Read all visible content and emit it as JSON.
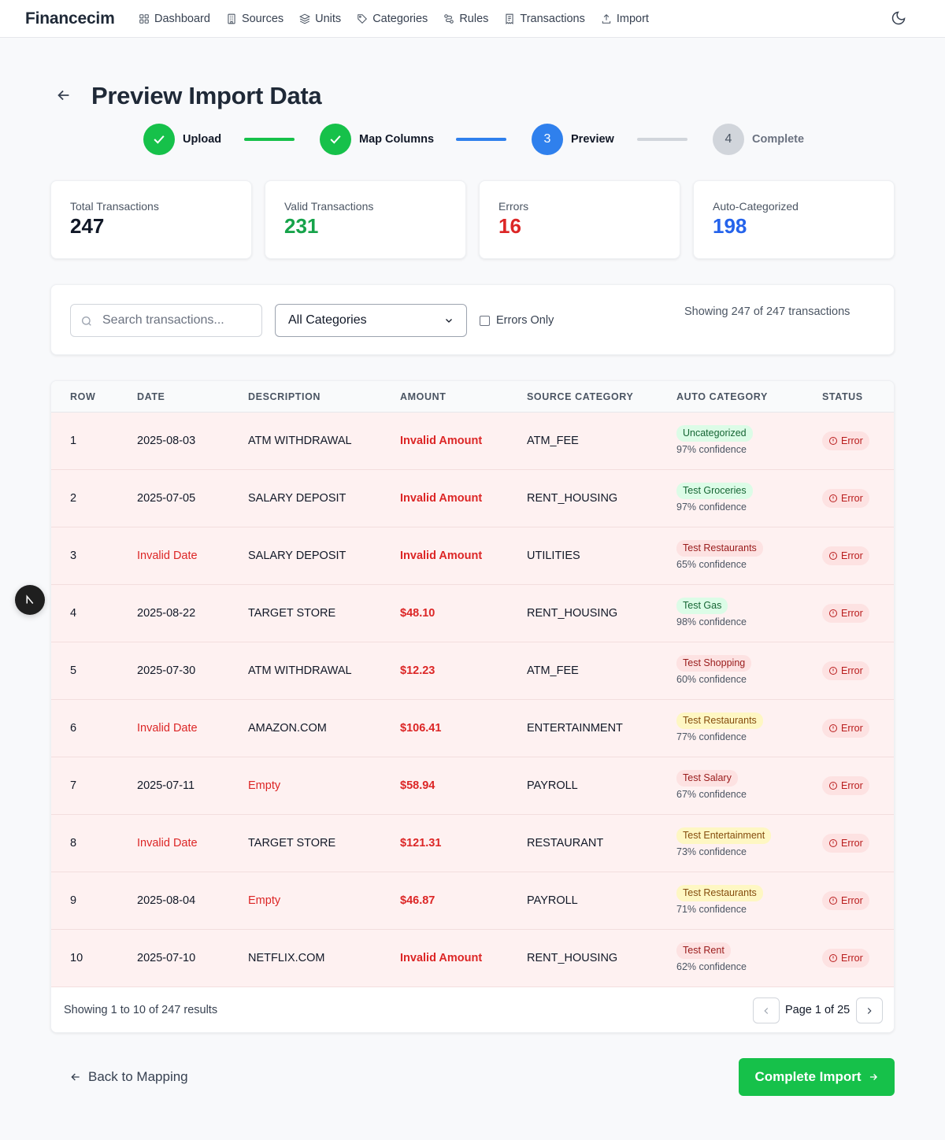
{
  "app": {
    "brand": "Financecim"
  },
  "nav": {
    "items": [
      {
        "label": "Dashboard",
        "icon": "grid-icon"
      },
      {
        "label": "Sources",
        "icon": "building-icon"
      },
      {
        "label": "Units",
        "icon": "layers-icon"
      },
      {
        "label": "Categories",
        "icon": "tag-icon"
      },
      {
        "label": "Rules",
        "icon": "route-icon"
      },
      {
        "label": "Transactions",
        "icon": "receipt-icon"
      },
      {
        "label": "Import",
        "icon": "upload-icon"
      }
    ],
    "theme_icon": "moon-icon"
  },
  "header": {
    "title": "Preview Import Data"
  },
  "stepper": {
    "steps": [
      {
        "label": "Upload",
        "state": "done",
        "marker": ""
      },
      {
        "label": "Map Columns",
        "state": "done",
        "marker": ""
      },
      {
        "label": "Preview",
        "state": "active",
        "marker": "3"
      },
      {
        "label": "Complete",
        "state": "todo",
        "marker": "4"
      }
    ]
  },
  "stats": [
    {
      "label": "Total Transactions",
      "value": "247",
      "color": "#111827"
    },
    {
      "label": "Valid Transactions",
      "value": "231",
      "color": "#16a34a"
    },
    {
      "label": "Errors",
      "value": "16",
      "color": "#dc2626"
    },
    {
      "label": "Auto-Categorized",
      "value": "198",
      "color": "#2563eb"
    }
  ],
  "filters": {
    "search_placeholder": "Search transactions...",
    "category_selected": "All Categories",
    "errors_only_label": "Errors Only",
    "showing_text": "Showing 247 of 247 transactions"
  },
  "table": {
    "headers": [
      "ROW",
      "DATE",
      "DESCRIPTION",
      "AMOUNT",
      "SOURCE CATEGORY",
      "AUTO CATEGORY",
      "STATUS"
    ],
    "rows": [
      {
        "row": "1",
        "date": "2025-08-03",
        "date_err": false,
        "desc": "ATM WITHDRAWAL",
        "desc_err": false,
        "amount": "Invalid Amount",
        "source": "ATM_FEE",
        "auto": "Uncategorized",
        "auto_tone": "green",
        "confidence": "97% confidence",
        "status": "Error"
      },
      {
        "row": "2",
        "date": "2025-07-05",
        "date_err": false,
        "desc": "SALARY DEPOSIT",
        "desc_err": false,
        "amount": "Invalid Amount",
        "source": "RENT_HOUSING",
        "auto": "Test Groceries",
        "auto_tone": "green",
        "confidence": "97% confidence",
        "status": "Error"
      },
      {
        "row": "3",
        "date": "Invalid Date",
        "date_err": true,
        "desc": "SALARY DEPOSIT",
        "desc_err": false,
        "amount": "Invalid Amount",
        "source": "UTILITIES",
        "auto": "Test Restaurants",
        "auto_tone": "red",
        "confidence": "65% confidence",
        "status": "Error"
      },
      {
        "row": "4",
        "date": "2025-08-22",
        "date_err": false,
        "desc": "TARGET STORE",
        "desc_err": false,
        "amount": "$48.10",
        "source": "RENT_HOUSING",
        "auto": "Test Gas",
        "auto_tone": "green",
        "confidence": "98% confidence",
        "status": "Error"
      },
      {
        "row": "5",
        "date": "2025-07-30",
        "date_err": false,
        "desc": "ATM WITHDRAWAL",
        "desc_err": false,
        "amount": "$12.23",
        "source": "ATM_FEE",
        "auto": "Test Shopping",
        "auto_tone": "red",
        "confidence": "60% confidence",
        "status": "Error"
      },
      {
        "row": "6",
        "date": "Invalid Date",
        "date_err": true,
        "desc": "AMAZON.COM",
        "desc_err": false,
        "amount": "$106.41",
        "source": "ENTERTAINMENT",
        "auto": "Test Restaurants",
        "auto_tone": "yellow",
        "confidence": "77% confidence",
        "status": "Error"
      },
      {
        "row": "7",
        "date": "2025-07-11",
        "date_err": false,
        "desc": "Empty",
        "desc_err": true,
        "amount": "$58.94",
        "source": "PAYROLL",
        "auto": "Test Salary",
        "auto_tone": "red",
        "confidence": "67% confidence",
        "status": "Error"
      },
      {
        "row": "8",
        "date": "Invalid Date",
        "date_err": true,
        "desc": "TARGET STORE",
        "desc_err": false,
        "amount": "$121.31",
        "source": "RESTAURANT",
        "auto": "Test Entertainment",
        "auto_tone": "yellow",
        "confidence": "73% confidence",
        "status": "Error"
      },
      {
        "row": "9",
        "date": "2025-08-04",
        "date_err": false,
        "desc": "Empty",
        "desc_err": true,
        "amount": "$46.87",
        "source": "PAYROLL",
        "auto": "Test Restaurants",
        "auto_tone": "yellow",
        "confidence": "71% confidence",
        "status": "Error"
      },
      {
        "row": "10",
        "date": "2025-07-10",
        "date_err": false,
        "desc": "NETFLIX.COM",
        "desc_err": false,
        "amount": "Invalid Amount",
        "source": "RENT_HOUSING",
        "auto": "Test Rent",
        "auto_tone": "red",
        "confidence": "62% confidence",
        "status": "Error"
      }
    ],
    "footer_text": "Showing 1 to 10 of 247 results",
    "page_text": "Page 1 of 25"
  },
  "actions": {
    "back_label": "Back to Mapping",
    "complete_label": "Complete Import"
  },
  "colors": {
    "accent_green": "#16c14a",
    "accent_blue": "#2f80ed",
    "error_red": "#dc2626"
  }
}
